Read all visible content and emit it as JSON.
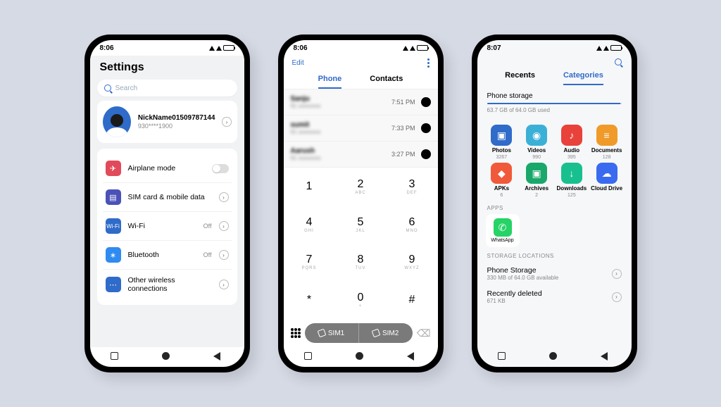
{
  "phone1": {
    "time": "8:06",
    "title": "Settings",
    "search_placeholder": "Search",
    "profile": {
      "name": "NickName01509787144",
      "sub": "930****1900"
    },
    "rows": [
      {
        "label": "Airplane mode",
        "icon_bg": "#e14a5a",
        "glyph": "✈"
      },
      {
        "label": "SIM card & mobile data",
        "icon_bg": "#4a52b8",
        "glyph": "▤"
      },
      {
        "label": "Wi-Fi",
        "aux": "Off",
        "icon_bg": "#2f6bc9",
        "glyph": "≋"
      },
      {
        "label": "Bluetooth",
        "aux": "Off",
        "icon_bg": "#2f8bf0",
        "glyph": "᚛"
      },
      {
        "label": "Other wireless connections",
        "icon_bg": "#2f6bc9",
        "glyph": "⋯"
      }
    ]
  },
  "phone2": {
    "time": "8:06",
    "edit": "Edit",
    "tabs": [
      "Phone",
      "Contacts"
    ],
    "calls": [
      {
        "name": "Sanju",
        "sub": "91 xxxxxxxx",
        "time": "7:51 PM"
      },
      {
        "name": "sumit",
        "sub": "91 xxxxxxxx",
        "time": "7:33 PM"
      },
      {
        "name": "Aarush",
        "sub": "91 xxxxxxxx",
        "time": "3:27 PM"
      }
    ],
    "keys": [
      {
        "n": "1",
        "s": ""
      },
      {
        "n": "2",
        "s": "ABC"
      },
      {
        "n": "3",
        "s": "DEF"
      },
      {
        "n": "4",
        "s": "GHI"
      },
      {
        "n": "5",
        "s": "JKL"
      },
      {
        "n": "6",
        "s": "MNO"
      },
      {
        "n": "7",
        "s": "PQRS"
      },
      {
        "n": "8",
        "s": "TUV"
      },
      {
        "n": "9",
        "s": "WXYZ"
      },
      {
        "n": "*",
        "s": ""
      },
      {
        "n": "0",
        "s": "+"
      },
      {
        "n": "#",
        "s": ""
      }
    ],
    "sim1": "SIM1",
    "sim2": "SIM2"
  },
  "phone3": {
    "time": "8:07",
    "tabs": [
      "Recents",
      "Categories"
    ],
    "storage": {
      "title": "Phone storage",
      "used": "63.7 GB of 64.0 GB used"
    },
    "cats": [
      {
        "label": "Photos",
        "count": "3267",
        "bg": "#2f6bc9",
        "g": "▣"
      },
      {
        "label": "Videos",
        "count": "990",
        "bg": "#3bb0d6",
        "g": "◉"
      },
      {
        "label": "Audio",
        "count": "395",
        "bg": "#e8423a",
        "g": "♪"
      },
      {
        "label": "Documents",
        "count": "128",
        "bg": "#f09a2a",
        "g": "≡"
      },
      {
        "label": "APKs",
        "count": "6",
        "bg": "#f05a3a",
        "g": "◆"
      },
      {
        "label": "Archives",
        "count": "2",
        "bg": "#1aa86a",
        "g": "▣"
      },
      {
        "label": "Downloads",
        "count": "125",
        "bg": "#18c090",
        "g": "↓"
      },
      {
        "label": "Cloud Drive",
        "count": "",
        "bg": "#3a6af0",
        "g": "☁"
      }
    ],
    "apps_head": "APPS",
    "app": "WhatsApp",
    "loc_head": "STORAGE LOCATIONS",
    "loc1": {
      "title": "Phone Storage",
      "sub": "330 MB of 64.0 GB available"
    },
    "loc2": {
      "title": "Recently deleted",
      "sub": "671 KB"
    }
  }
}
